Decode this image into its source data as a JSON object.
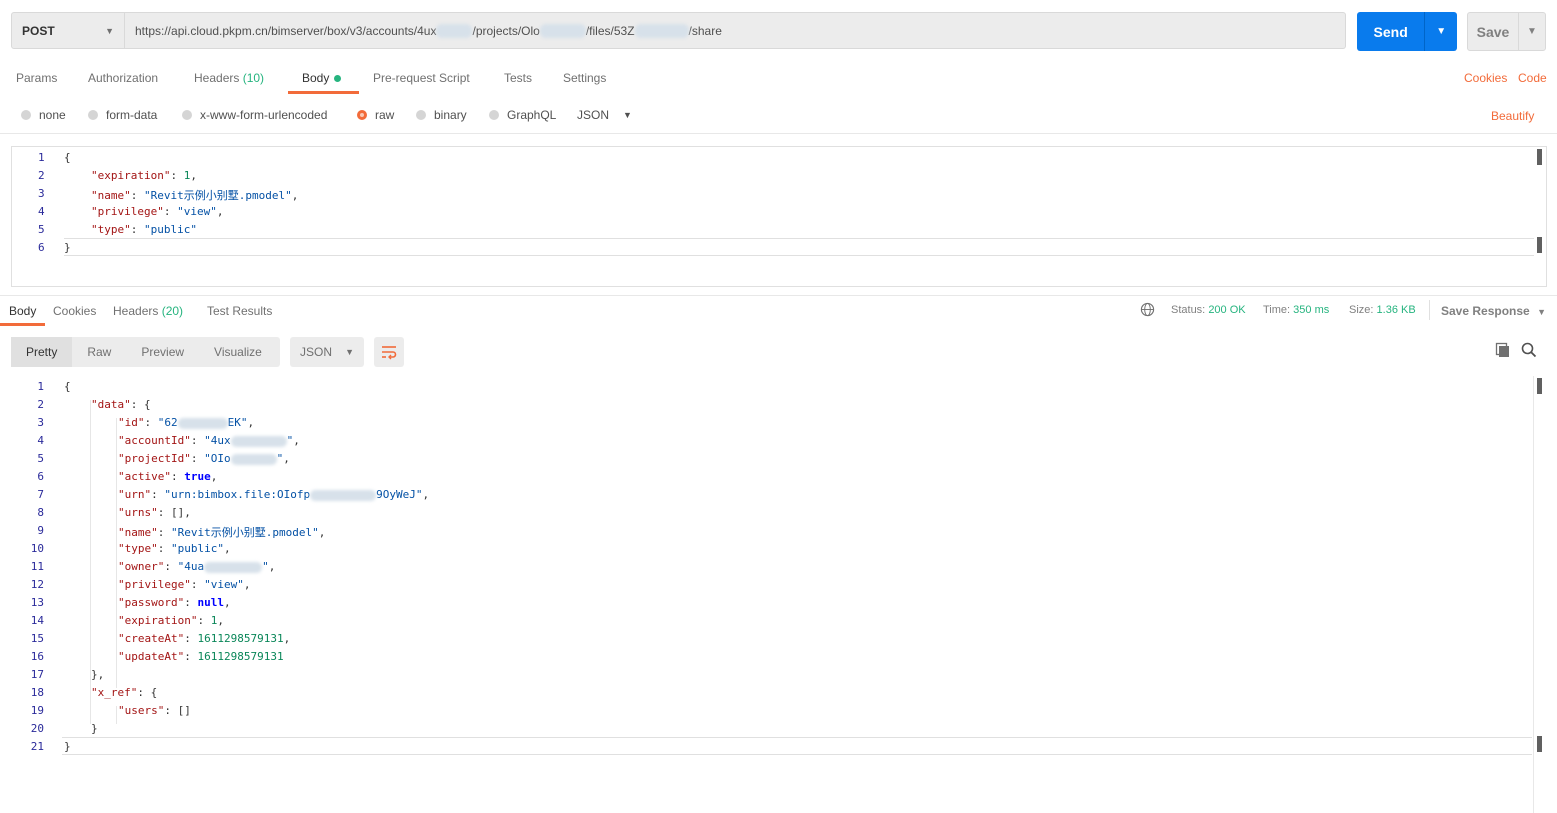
{
  "request": {
    "method": "POST",
    "url_parts": [
      "https://api.cloud.pkpm.cn/bimserver/box/v3/accounts/4ux",
      "/projects/Olo",
      "/files/53Z",
      "/share"
    ],
    "send_label": "Send",
    "save_label": "Save"
  },
  "request_tabs": {
    "params": "Params",
    "authorization": "Authorization",
    "headers": "Headers",
    "headers_count": "(10)",
    "body": "Body",
    "pre_request": "Pre-request Script",
    "tests": "Tests",
    "settings": "Settings",
    "cookies_link": "Cookies",
    "code_link": "Code"
  },
  "body_types": {
    "none": "none",
    "form_data": "form-data",
    "urlencoded": "x-www-form-urlencoded",
    "raw": "raw",
    "binary": "binary",
    "graphql": "GraphQL",
    "format": "JSON",
    "beautify": "Beautify"
  },
  "request_body_lines": [
    "1",
    "2",
    "3",
    "4",
    "5",
    "6"
  ],
  "response_tabs": {
    "body": "Body",
    "cookies": "Cookies",
    "headers": "Headers",
    "headers_count": "(20)",
    "test_results": "Test Results"
  },
  "response_meta": {
    "status_label": "Status:",
    "status_value": "200 OK",
    "time_label": "Time:",
    "time_value": "350 ms",
    "size_label": "Size:",
    "size_value": "1.36 KB",
    "save_response": "Save Response"
  },
  "response_view": {
    "pretty": "Pretty",
    "raw": "Raw",
    "preview": "Preview",
    "visualize": "Visualize",
    "format": "JSON"
  },
  "request_body": {
    "expiration_key": "\"expiration\"",
    "expiration_val": "1",
    "name_key": "\"name\"",
    "name_val": "\"Revit示例小别墅.pmodel\"",
    "privilege_key": "\"privilege\"",
    "privilege_val": "\"view\"",
    "type_key": "\"type\"",
    "type_val": "\"public\""
  },
  "response_body": {
    "data_key": "\"data\"",
    "id_key": "\"id\"",
    "id_val_a": "\"62",
    "id_val_b": "EK\"",
    "accountId_key": "\"accountId\"",
    "accountId_val_a": "\"4ux",
    "accountId_val_b": "\"",
    "projectId_key": "\"projectId\"",
    "projectId_val_a": "\"OIo",
    "projectId_val_b": "\"",
    "active_key": "\"active\"",
    "active_val": "true",
    "urn_key": "\"urn\"",
    "urn_val_a": "\"urn:bimbox.file:OIofp",
    "urn_val_b": "9OyWeJ\"",
    "urns_key": "\"urns\"",
    "urns_val": "[]",
    "name_key": "\"name\"",
    "name_val": "\"Revit示例小别墅.pmodel\"",
    "type_key": "\"type\"",
    "type_val": "\"public\"",
    "owner_key": "\"owner\"",
    "owner_val_a": "\"4ua",
    "owner_val_b": "\"",
    "privilege_key": "\"privilege\"",
    "privilege_val": "\"view\"",
    "password_key": "\"password\"",
    "password_val": "null",
    "expiration_key": "\"expiration\"",
    "expiration_val": "1",
    "createAt_key": "\"createAt\"",
    "createAt_val": "1611298579131",
    "updateAt_key": "\"updateAt\"",
    "updateAt_val": "1611298579131",
    "xref_key": "\"x_ref\"",
    "users_key": "\"users\"",
    "users_val": "[]"
  },
  "response_line_numbers": [
    "1",
    "2",
    "3",
    "4",
    "5",
    "6",
    "7",
    "8",
    "9",
    "10",
    "11",
    "12",
    "13",
    "14",
    "15",
    "16",
    "17",
    "18",
    "19",
    "20",
    "21"
  ]
}
